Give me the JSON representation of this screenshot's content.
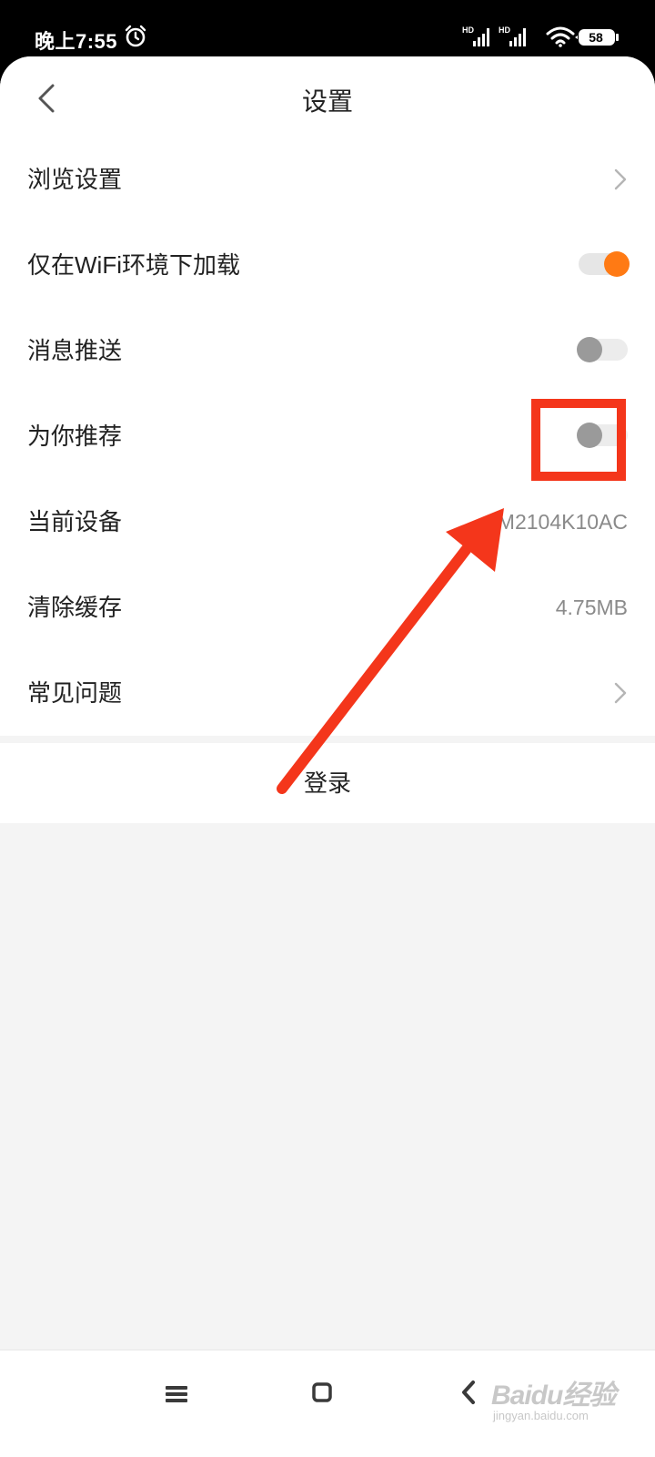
{
  "status_bar": {
    "time": "晚上7:55",
    "signal_1_label": "HD",
    "signal_2_label": "HD",
    "battery": "58"
  },
  "header": {
    "title": "设置"
  },
  "settings": [
    {
      "label": "浏览设置",
      "type": "link"
    },
    {
      "label": "仅在WiFi环境下加载",
      "type": "toggle",
      "on": true
    },
    {
      "label": "消息推送",
      "type": "toggle",
      "on": false
    },
    {
      "label": "为你推荐",
      "type": "toggle",
      "on": false
    },
    {
      "label": "当前设备",
      "type": "value",
      "value": "M2104K10AC"
    },
    {
      "label": "清除缓存",
      "type": "value",
      "value": "4.75MB"
    },
    {
      "label": "常见问题",
      "type": "link"
    }
  ],
  "login": {
    "label": "登录"
  },
  "watermark": {
    "logo": "Baidu经验",
    "sub": "jingyan.baidu.com"
  },
  "colors": {
    "accent": "#ff7a14",
    "annotation": "#f4361b"
  }
}
